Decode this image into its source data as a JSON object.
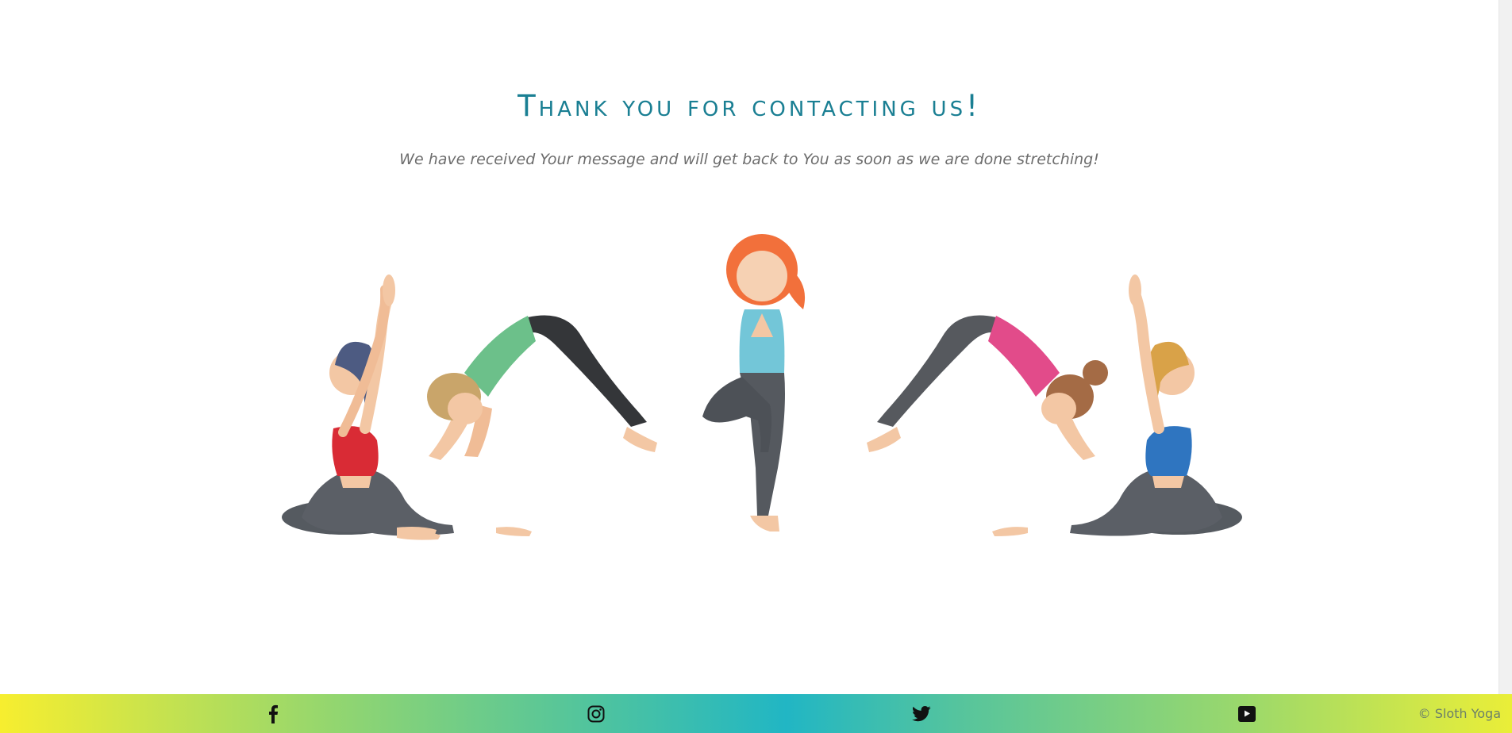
{
  "page": {
    "title": "Thank you for contacting us!",
    "message": "We have received Your message and will get back to You as soon as we are done stretching!"
  },
  "illustration": {
    "description_icon": "yoga-group-illustration"
  },
  "footer": {
    "social": [
      {
        "name": "facebook",
        "icon": "facebook-icon"
      },
      {
        "name": "instagram",
        "icon": "instagram-icon"
      },
      {
        "name": "twitter",
        "icon": "twitter-icon"
      },
      {
        "name": "youtube",
        "icon": "youtube-icon"
      }
    ],
    "copyright": "© Sloth Yoga"
  },
  "colors": {
    "title": "#1a7f93",
    "subtitle": "#6d6d6d",
    "footer_gradient_start": "#f7ee2f",
    "footer_gradient_center": "#21b6c4",
    "footer_gradient_end": "#eaee38"
  }
}
